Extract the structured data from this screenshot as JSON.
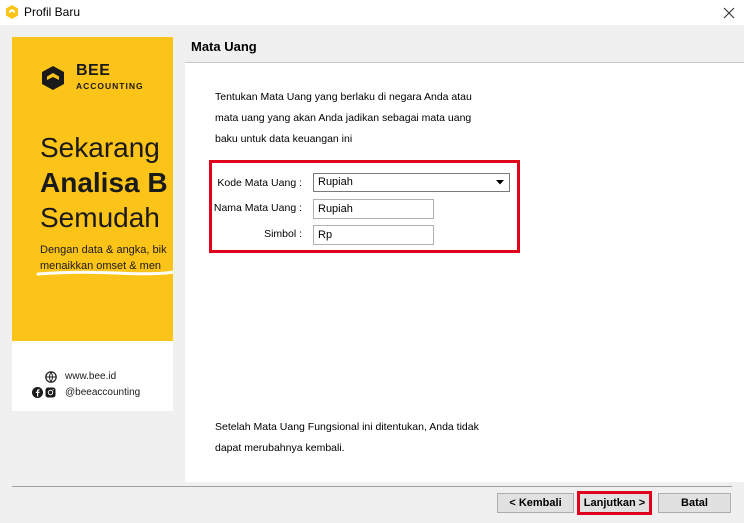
{
  "window": {
    "title": "Profil Baru",
    "icon": "bee-logo-icon",
    "close_icon": "close-icon"
  },
  "banner": {
    "logo_name": "BEE",
    "logo_sub": "ACCOUNTING",
    "headline_1": "Sekarang",
    "headline_2": "Analisa B",
    "headline_3": "Semudah",
    "body_1": "Dengan data & angka, bik",
    "body_2": "menaikkan omset & men",
    "website": "www.bee.id",
    "social": "@beeaccounting",
    "colors": {
      "brand_yellow": "#fcc419",
      "dark": "#1a1a1a"
    }
  },
  "section": {
    "title": "Mata Uang",
    "intro_1": "Tentukan Mata Uang yang berlaku di negara Anda atau",
    "intro_2": "mata uang yang akan Anda jadikan sebagai mata uang",
    "intro_3": "baku untuk data keuangan ini"
  },
  "form": {
    "kode_label": "Kode Mata Uang :",
    "kode_value": "Rupiah",
    "nama_label": "Nama Mata Uang :",
    "nama_value": "Rupiah",
    "simbol_label": "Simbol :",
    "simbol_value": "Rp",
    "highlight_color": "#e0001b"
  },
  "note": {
    "line_1": "Setelah Mata Uang Fungsional ini ditentukan, Anda tidak",
    "line_2": "dapat merubahnya kembali."
  },
  "buttons": {
    "back": "< Kembali",
    "next": "Lanjutkan >",
    "cancel": "Batal"
  }
}
